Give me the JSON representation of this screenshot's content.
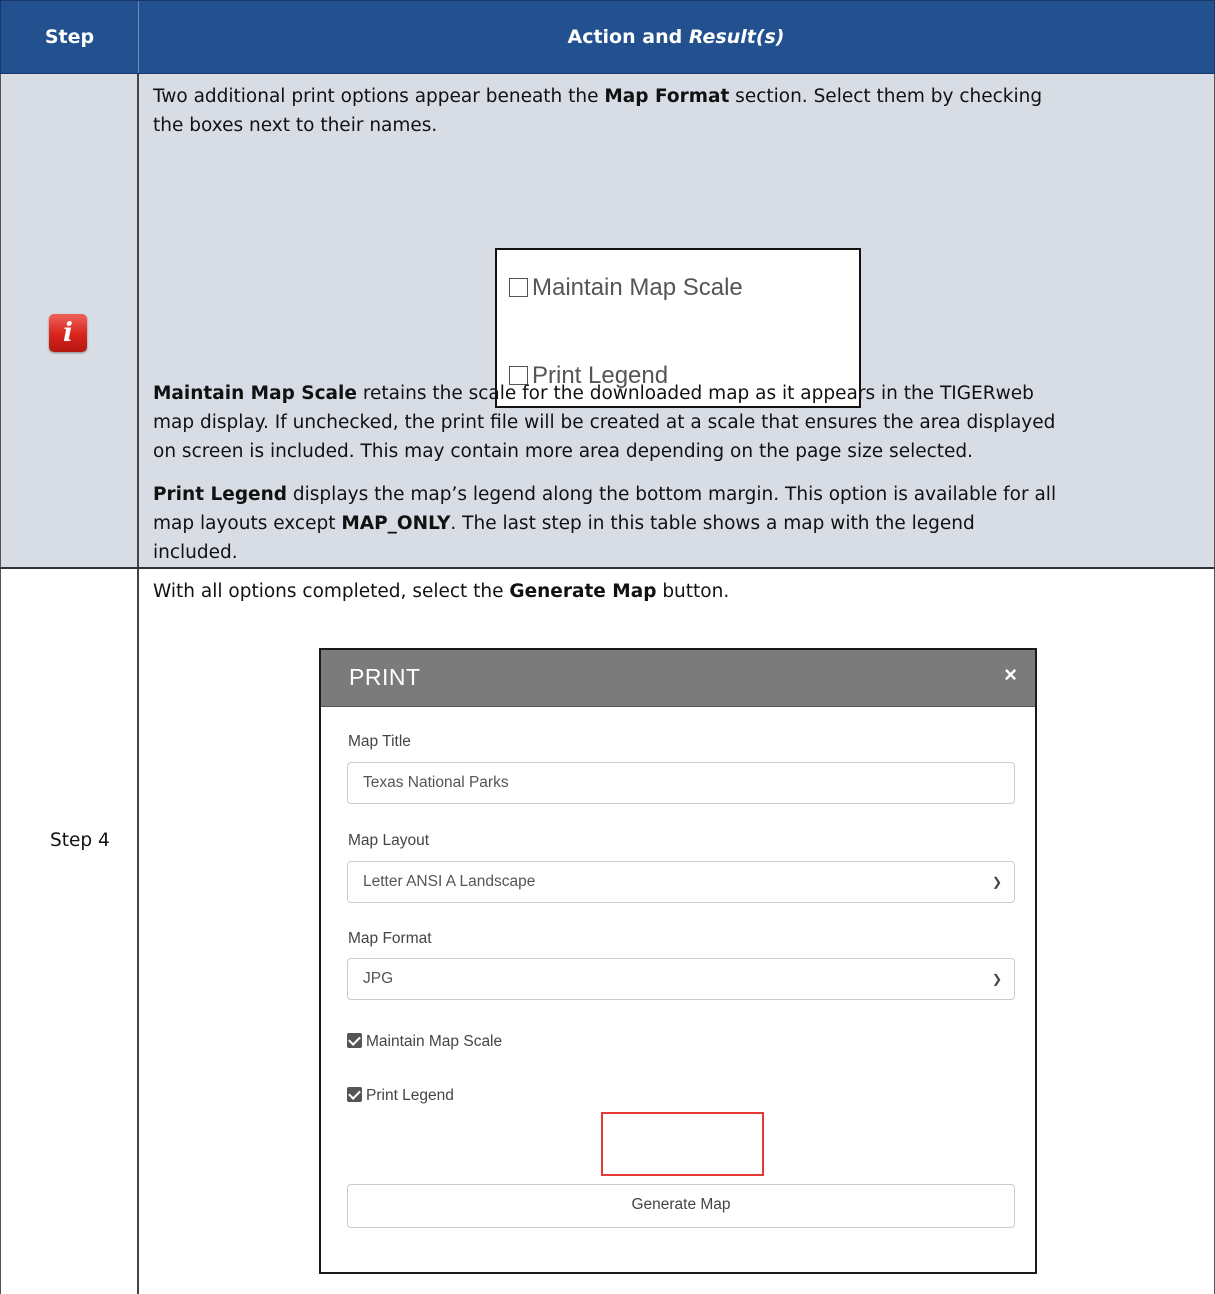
{
  "table": {
    "header": {
      "step": "Step",
      "action": "Action and ",
      "result": "Result(s)"
    }
  },
  "row1": {
    "icon": "info-icon",
    "intro_a": "Two additional print options appear beneath the ",
    "intro_b": "Map Format",
    "intro_c": " section. Select them by checking",
    "intro_d": "the boxes next to their names.",
    "options": [
      "Maintain Map Scale",
      "Print Legend"
    ],
    "p2_b": "Maintain Map Scale",
    "p2_l1": " retains the scale for the downloaded map as it appears in the TIGERweb",
    "p2_l2": "map display. If unchecked, the print file will be created at a scale that ensures the area displayed",
    "p2_l3": "on screen is included. This may contain more area depending on the page size selected.",
    "p3_b": "Print Legend",
    "p3_l1": " displays the map’s legend along the bottom margin. This option is available for all",
    "p3_l2a": "map layouts except ",
    "p3_l2b": "MAP_ONLY",
    "p3_l2c": ". The last step in this table shows a map with the legend",
    "p3_l3": "included."
  },
  "row2": {
    "step": "Step 4",
    "intro_a": "With all options completed, select the ",
    "intro_b": "Generate Map",
    "intro_c": " button.",
    "dialog": {
      "title": "PRINT",
      "close": "×",
      "map_title_label": "Map Title",
      "map_title_value": "Texas National Parks",
      "layout_label": "Map Layout",
      "layout_value": "Letter ANSI A Landscape",
      "format_label": "Map Format",
      "format_value": "JPG",
      "maintain_scale": "Maintain Map Scale",
      "print_legend": "Print Legend",
      "generate": "Generate Map"
    }
  }
}
